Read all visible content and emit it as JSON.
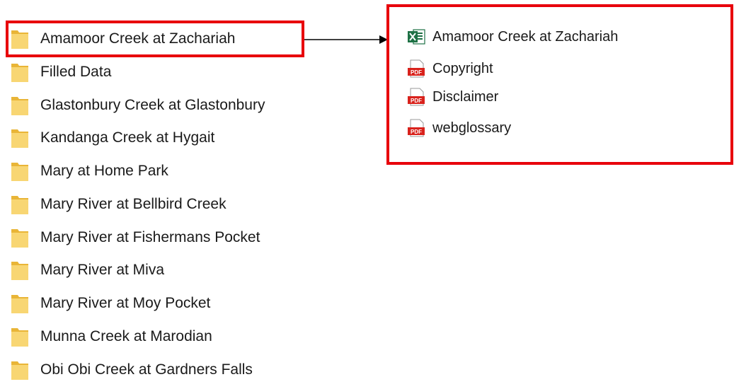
{
  "folders": [
    {
      "name": "Amamoor Creek at Zachariah"
    },
    {
      "name": "Filled Data"
    },
    {
      "name": "Glastonbury Creek at Glastonbury"
    },
    {
      "name": "Kandanga Creek at Hygait"
    },
    {
      "name": "Mary at Home Park"
    },
    {
      "name": "Mary River at Bellbird Creek"
    },
    {
      "name": "Mary River at Fishermans Pocket"
    },
    {
      "name": "Mary River at Miva"
    },
    {
      "name": "Mary River at Moy Pocket"
    },
    {
      "name": "Munna Creek at Marodian"
    },
    {
      "name": "Obi Obi Creek at Gardners Falls"
    }
  ],
  "files": [
    {
      "name": "Amamoor Creek at Zachariah",
      "icon": "excel-icon"
    },
    {
      "name": "Copyright",
      "icon": "pdf-icon"
    },
    {
      "name": "Disclaimer",
      "icon": "pdf-icon"
    },
    {
      "name": "webglossary",
      "icon": "pdf-icon"
    }
  ],
  "colors": {
    "highlight": "#e8000b",
    "folder": "#f5c242",
    "excel": "#1e7145",
    "pdf": "#d9221c"
  }
}
